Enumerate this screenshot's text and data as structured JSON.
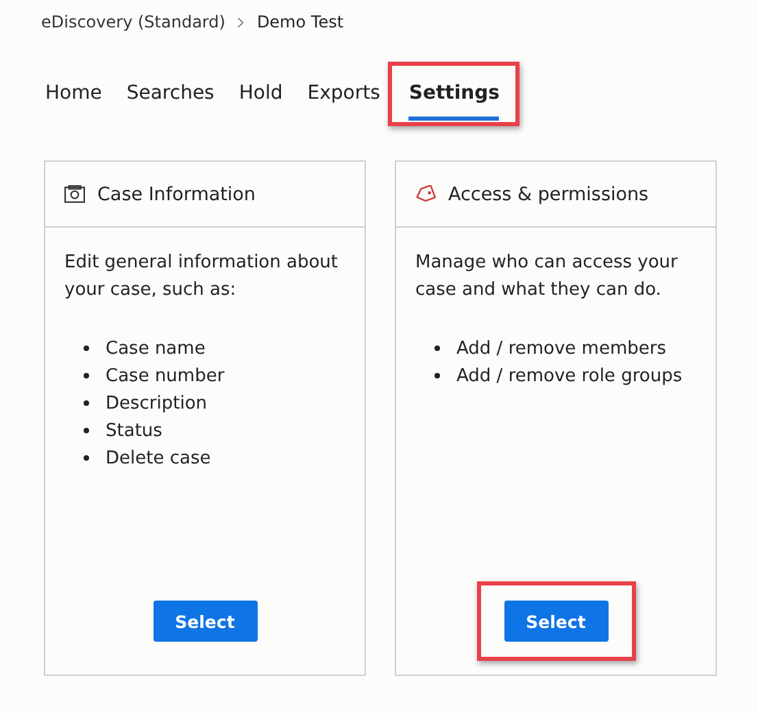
{
  "breadcrumb": [
    {
      "label": "eDiscovery (Standard)"
    },
    {
      "label": "Demo Test"
    }
  ],
  "tabs": [
    {
      "label": "Home",
      "selected": false,
      "highlighted": false
    },
    {
      "label": "Searches",
      "selected": false,
      "highlighted": false
    },
    {
      "label": "Hold",
      "selected": false,
      "highlighted": false
    },
    {
      "label": "Exports",
      "selected": false,
      "highlighted": false
    },
    {
      "label": "Settings",
      "selected": true,
      "highlighted": true
    }
  ],
  "cards": [
    {
      "kind": "camera",
      "title": "Case Information",
      "description": "Edit general information about your case, such as:",
      "items": [
        "Case name",
        "Case number",
        "Description",
        "Status",
        "Delete case"
      ],
      "button": {
        "label": "Select",
        "highlighted": false
      }
    },
    {
      "kind": "tag",
      "title": "Access & permissions",
      "description": "Manage who can access your case and what they can do.",
      "items": [
        "Add / remove members",
        "Add / remove role groups"
      ],
      "button": {
        "label": "Select",
        "highlighted": true
      }
    }
  ]
}
